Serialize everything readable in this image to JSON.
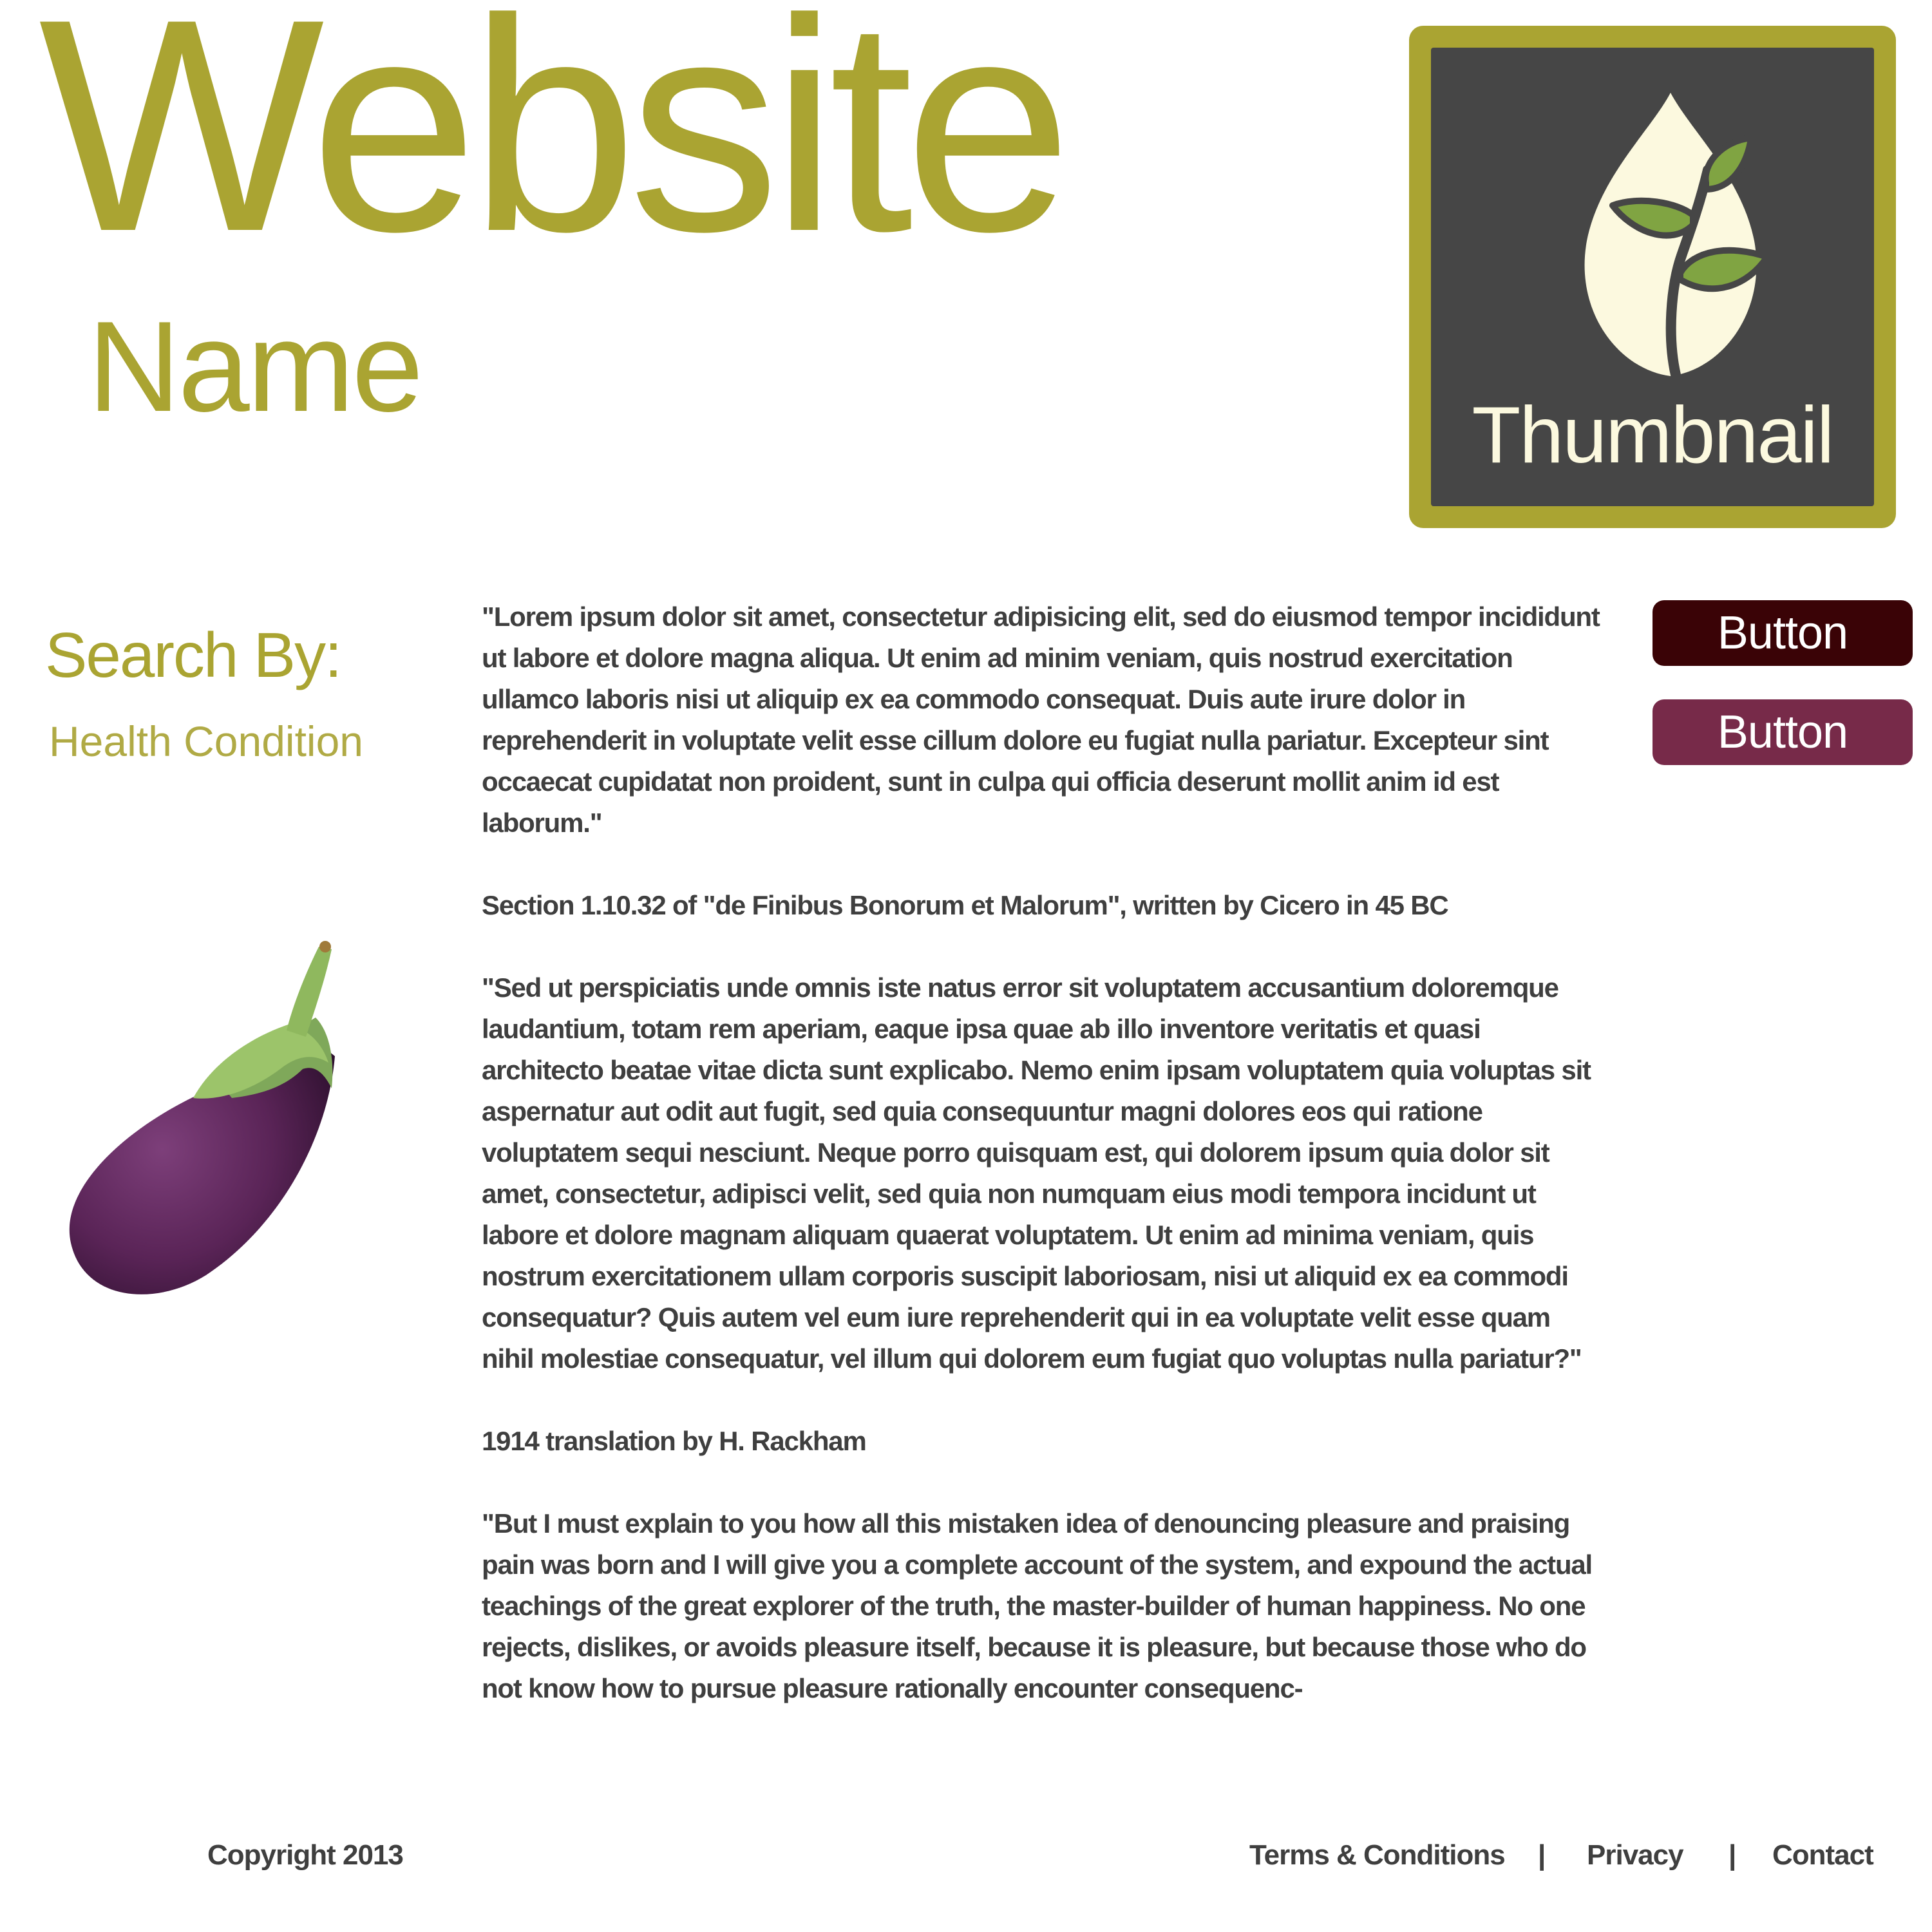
{
  "header": {
    "title": "Website",
    "subtitle": "Name"
  },
  "thumbnail": {
    "label": "Thumbnail",
    "icon": "leaf-drop-logo",
    "colors": {
      "frame": "#aaa432",
      "background": "#464646",
      "drop": "#fcf9df",
      "leaf": "#80a442"
    }
  },
  "sidebar": {
    "heading": "Search By:",
    "filter": "Health Condition",
    "image": "eggplant-image"
  },
  "actions": {
    "primary_button": "Button",
    "secondary_button": "Button",
    "colors": {
      "primary": "#3a0306",
      "secondary": "#772a49"
    }
  },
  "content": {
    "paragraphs": [
      "\"Lorem ipsum dolor sit amet, consectetur adipisicing elit, sed do eiusmod tempor incididunt ut labore et dolore magna aliqua. Ut enim ad minim veniam, quis nostrud exercitation ullamco laboris nisi ut aliquip ex ea commodo consequat. Duis aute irure dolor in reprehenderit in voluptate velit esse cillum dolore eu fugiat nulla pariatur. Excepteur sint occaecat cupidatat non proident, sunt in culpa qui officia deserunt mollit anim id est laborum.\"",
      "Section 1.10.32 of \"de Finibus Bonorum et Malorum\", written by Cicero in 45 BC",
      "\"Sed ut perspiciatis unde omnis iste natus error sit voluptatem accusantium doloremque laudantium, totam rem aperiam, eaque ipsa quae ab illo inventore veritatis et quasi architecto beatae vitae dicta sunt explicabo. Nemo enim ipsam voluptatem quia voluptas sit aspernatur aut odit aut fugit, sed quia consequuntur magni dolores eos qui ratione voluptatem sequi nesciunt. Neque porro quisquam est, qui dolorem ipsum quia dolor sit amet, consectetur, adipisci velit, sed quia non numquam eius modi tempora incidunt ut labore et dolore magnam aliquam quaerat voluptatem. Ut enim ad minima veniam, quis nostrum exercitationem ullam corporis suscipit laboriosam, nisi ut aliquid ex ea commodi consequatur? Quis autem vel eum iure reprehenderit qui in ea voluptate velit esse quam nihil molestiae consequatur, vel illum qui dolorem eum fugiat quo voluptas nulla pariatur?\"",
      "1914 translation by H. Rackham",
      "\"But I must explain to you how all this mistaken idea of denouncing pleasure and praising pain was born and I will give you a complete account of the system, and expound the actual teachings of the great explorer of the truth, the master-builder of human happiness. No one rejects, dislikes, or avoids pleasure itself, because it is pleasure, but because those who do not know how to pursue pleasure rationally encounter consequenc-"
    ]
  },
  "footer": {
    "copyright": "Copyright 2013",
    "links": [
      "Terms & Conditions",
      "Privacy",
      "Contact"
    ],
    "separator": "|"
  },
  "theme": {
    "accent": "#aaa432",
    "text": "#3f3f3f"
  }
}
